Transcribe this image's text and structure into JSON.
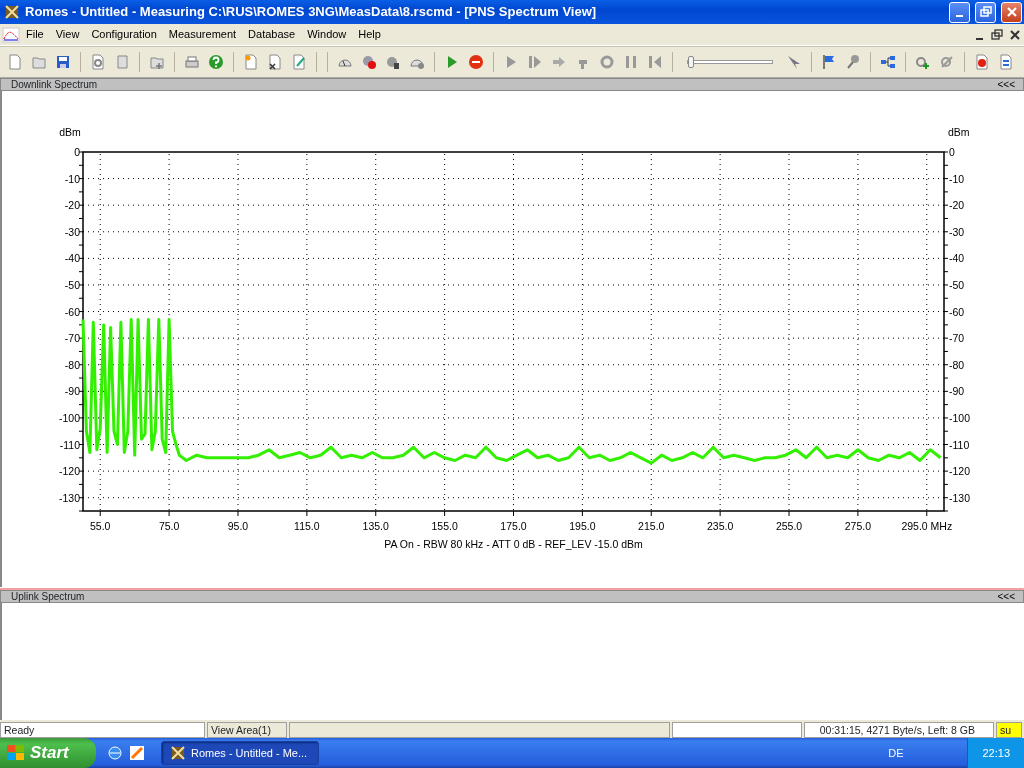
{
  "window": {
    "title": "Romes - Untitled - Measuring C:\\RUS\\ROMES 3NG\\MeasData\\8.rscmd - [PNS Spectrum View]"
  },
  "menu": [
    "File",
    "View",
    "Configuration",
    "Measurement",
    "Database",
    "Window",
    "Help"
  ],
  "toolbar": {
    "replay_slider": {
      "level": 0
    }
  },
  "panels": [
    {
      "title": "Downlink Spectrum",
      "collapse": "<<<",
      "right_ylabel": "dBm",
      "right_yticks": [
        "0",
        "-10",
        "-20",
        "-30",
        "-40",
        "-50",
        "-60",
        "-70",
        "-80",
        "-90",
        "-100",
        "-110",
        "-120",
        "-130"
      ],
      "chart_data": {
        "type": "line",
        "grid": true,
        "xlabel": "PA On - RBW 80 kHz - ATT 0 dB - REF_LEV -15.0 dBm",
        "ylabel": "dBm",
        "xlim": [
          50,
          300
        ],
        "ylim": [
          -135,
          0
        ],
        "xticks": [
          {
            "value": 55,
            "label": "55.0"
          },
          {
            "value": 75,
            "label": "75.0"
          },
          {
            "value": 95,
            "label": "95.0"
          },
          {
            "value": 115,
            "label": "115.0"
          },
          {
            "value": 135,
            "label": "135.0"
          },
          {
            "value": 155,
            "label": "155.0"
          },
          {
            "value": 175,
            "label": "175.0"
          },
          {
            "value": 195,
            "label": "195.0"
          },
          {
            "value": 215,
            "label": "215.0"
          },
          {
            "value": 235,
            "label": "235.0"
          },
          {
            "value": 255,
            "label": "255.0"
          },
          {
            "value": 275,
            "label": "275.0"
          },
          {
            "value": 295,
            "label": "295.0 MHz"
          }
        ],
        "yticks": [
          0,
          -10,
          -20,
          -30,
          -40,
          -50,
          -60,
          -70,
          -80,
          -90,
          -100,
          -110,
          -120,
          -130
        ],
        "x": [
          50,
          51,
          52,
          53,
          54,
          55,
          56,
          57,
          58,
          59,
          60,
          61,
          62,
          63,
          64,
          65,
          66,
          67,
          68,
          69,
          70,
          71,
          72,
          73,
          74,
          75,
          76,
          77,
          78,
          80,
          83,
          86,
          89,
          92,
          95,
          98,
          101,
          104,
          107,
          110,
          113,
          116,
          119,
          122,
          125,
          128,
          131,
          134,
          137,
          140,
          143,
          146,
          149,
          152,
          155,
          158,
          161,
          164,
          167,
          170,
          173,
          176,
          179,
          182,
          185,
          188,
          191,
          194,
          197,
          200,
          203,
          206,
          209,
          212,
          215,
          218,
          221,
          224,
          227,
          230,
          233,
          236,
          239,
          242,
          245,
          248,
          251,
          254,
          257,
          260,
          263,
          266,
          269,
          272,
          275,
          278,
          281,
          284,
          287,
          290,
          293,
          296,
          299
        ],
        "series": [
          {
            "color": "#33f000",
            "values": [
              -63,
              -105,
              -113,
              -64,
              -112,
              -104,
              -65,
              -113,
              -66,
              -105,
              -110,
              -64,
              -113,
              -105,
              -63,
              -114,
              -63,
              -108,
              -106,
              -63,
              -112,
              -105,
              -63,
              -108,
              -113,
              -63,
              -105,
              -110,
              -114,
              -116,
              -114,
              -115,
              -115,
              -115,
              -115,
              -115,
              -114,
              -112,
              -115,
              -114,
              -113,
              -115,
              -114,
              -111,
              -115,
              -114,
              -115,
              -113,
              -115,
              -115,
              -114,
              -111,
              -115,
              -113,
              -115,
              -116,
              -114,
              -115,
              -111,
              -115,
              -116,
              -114,
              -112,
              -115,
              -114,
              -116,
              -115,
              -111,
              -115,
              -114,
              -116,
              -115,
              -113,
              -115,
              -117,
              -114,
              -116,
              -115,
              -113,
              -115,
              -111,
              -115,
              -114,
              -115,
              -116,
              -115,
              -115,
              -114,
              -112,
              -115,
              -111,
              -115,
              -114,
              -115,
              -112,
              -115,
              -116,
              -114,
              -115,
              -113,
              -116,
              -112,
              -115
            ]
          }
        ]
      }
    },
    {
      "title": "Uplink Spectrum",
      "collapse": "<<<"
    }
  ],
  "status_bar": {
    "state": "Ready",
    "view": "View Area(1)",
    "stats": "00:31:15, 4271 Byte/s, Left: 8 GB",
    "indicator": "su"
  },
  "taskbar": {
    "start": "Start",
    "tasks": [
      {
        "label": "Romes - Untitled - Me...",
        "selected": true
      }
    ],
    "language": "DE",
    "clock": "22:13"
  }
}
